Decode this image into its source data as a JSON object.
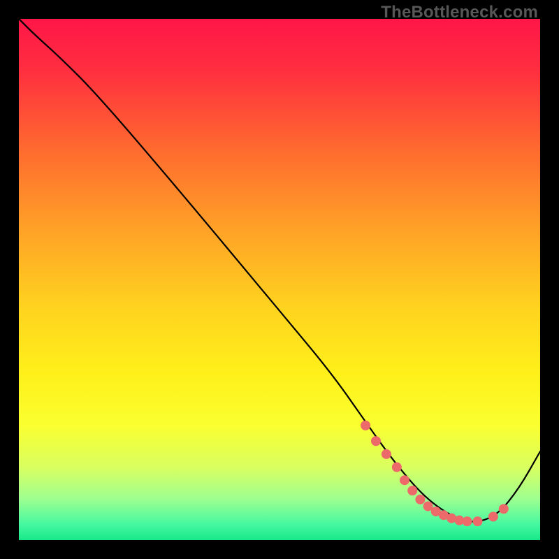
{
  "watermark": "TheBottleneck.com",
  "chart_data": {
    "type": "line",
    "title": "",
    "xlabel": "",
    "ylabel": "",
    "xlim": [
      0,
      100
    ],
    "ylim": [
      0,
      100
    ],
    "grid": false,
    "legend": false,
    "background_gradient": {
      "stops": [
        {
          "offset": 0.0,
          "color": "#ff1648"
        },
        {
          "offset": 0.1,
          "color": "#ff2f3f"
        },
        {
          "offset": 0.25,
          "color": "#ff6a2f"
        },
        {
          "offset": 0.4,
          "color": "#ffa027"
        },
        {
          "offset": 0.55,
          "color": "#ffd21f"
        },
        {
          "offset": 0.68,
          "color": "#fff01a"
        },
        {
          "offset": 0.78,
          "color": "#faff30"
        },
        {
          "offset": 0.86,
          "color": "#d9ff60"
        },
        {
          "offset": 0.92,
          "color": "#9fff90"
        },
        {
          "offset": 0.97,
          "color": "#45f8a0"
        },
        {
          "offset": 1.0,
          "color": "#18e88a"
        }
      ]
    },
    "curve": {
      "x": [
        0.0,
        3.0,
        8.0,
        15.0,
        30.0,
        50.0,
        60.0,
        67.0,
        72.0,
        78.0,
        84.0,
        88.0,
        92.0,
        96.0,
        100.0
      ],
      "y": [
        100.0,
        97.0,
        92.5,
        85.5,
        68.0,
        44.0,
        32.0,
        22.0,
        15.0,
        8.0,
        4.0,
        3.3,
        5.0,
        10.0,
        17.0
      ]
    },
    "marker_points": {
      "x": [
        66.5,
        68.5,
        70.5,
        72.5,
        74.0,
        75.5,
        77.0,
        78.5,
        80.0,
        81.5,
        83.0,
        84.5,
        86.0,
        88.0,
        91.0,
        93.0
      ],
      "y": [
        22.0,
        19.0,
        16.5,
        14.0,
        11.5,
        9.5,
        7.8,
        6.5,
        5.5,
        4.8,
        4.2,
        3.8,
        3.6,
        3.6,
        4.5,
        6.0
      ],
      "color": "#ec6a6a",
      "radius": 7
    }
  }
}
